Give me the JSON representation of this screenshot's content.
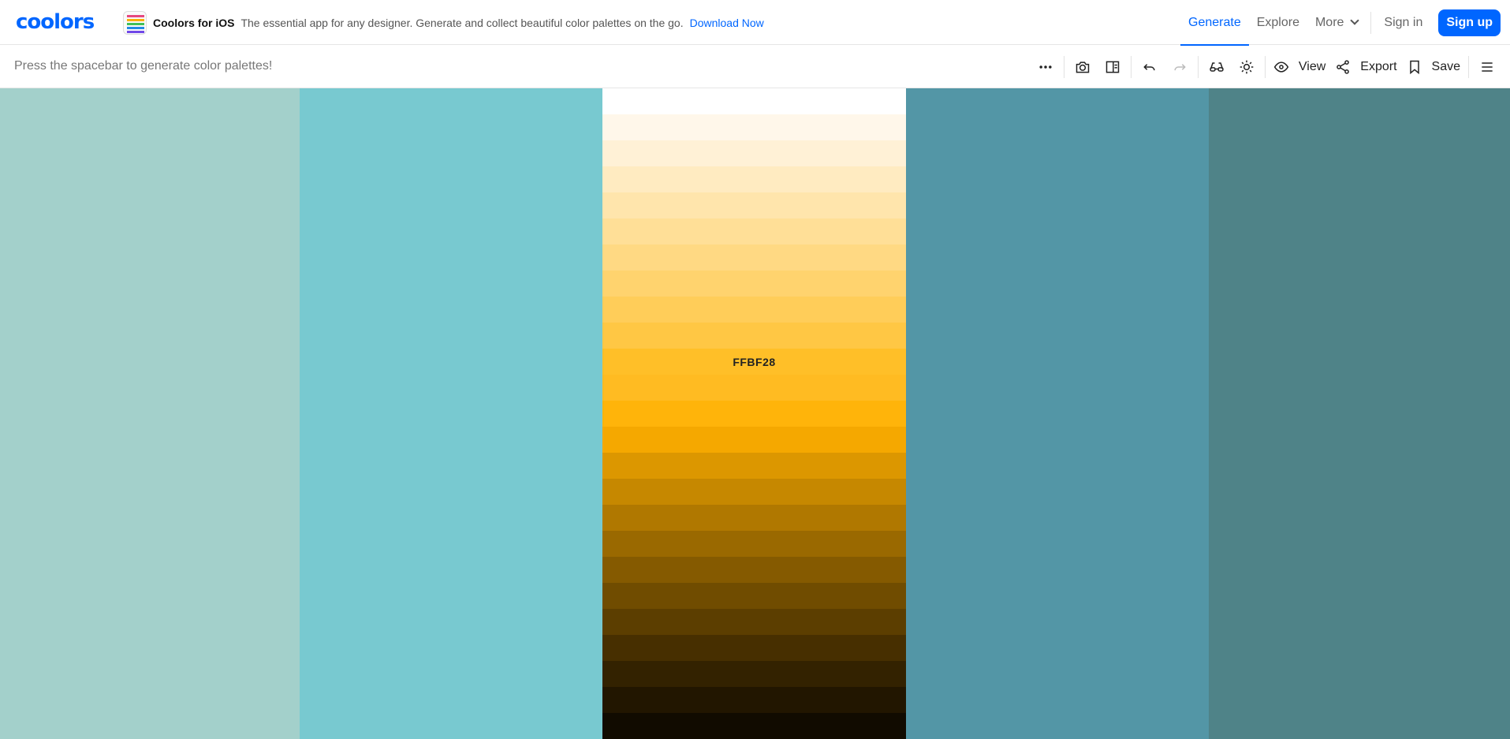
{
  "brand": {
    "name": "coolors",
    "color": "#0066ff"
  },
  "promo": {
    "title": "Coolors for iOS",
    "description": "The essential app for any designer. Generate and collect beautiful color palettes on the go.",
    "link": "Download Now"
  },
  "nav": {
    "generate": "Generate",
    "explore": "Explore",
    "more": "More",
    "signin": "Sign in",
    "signup": "Sign up"
  },
  "toolbar": {
    "hint": "Press the spacebar to generate color palettes!",
    "view": "View",
    "export": "Export",
    "save": "Save",
    "icons": [
      "more-options-icon",
      "camera-icon",
      "side-panel-icon",
      "undo-icon",
      "redo-icon",
      "glasses-icon",
      "brightness-icon",
      "eye-icon",
      "share-icon",
      "bookmark-icon",
      "menu-icon"
    ]
  },
  "palette": {
    "columns": [
      {
        "color": "#a3d0cb"
      },
      {
        "color": "#78c9d0"
      },
      {
        "color": "#ffbf28",
        "shades_open": true
      },
      {
        "color": "#5396a6"
      },
      {
        "color": "#4f8388"
      }
    ],
    "shades": [
      "#ffffff",
      "#fff7ea",
      "#fff1d6",
      "#ffebc1",
      "#ffe5ac",
      "#ffdf97",
      "#ffd983",
      "#ffd36e",
      "#ffcd59",
      "#ffc744",
      "#ffbf28",
      "#ffbb22",
      "#ffb40a",
      "#f5a800",
      "#dc9700",
      "#c68800",
      "#b07800",
      "#9a6900",
      "#855a00",
      "#704c00",
      "#5c3e00",
      "#472f00",
      "#332200",
      "#221600",
      "#110b00"
    ],
    "active_label": "FFBF28"
  }
}
